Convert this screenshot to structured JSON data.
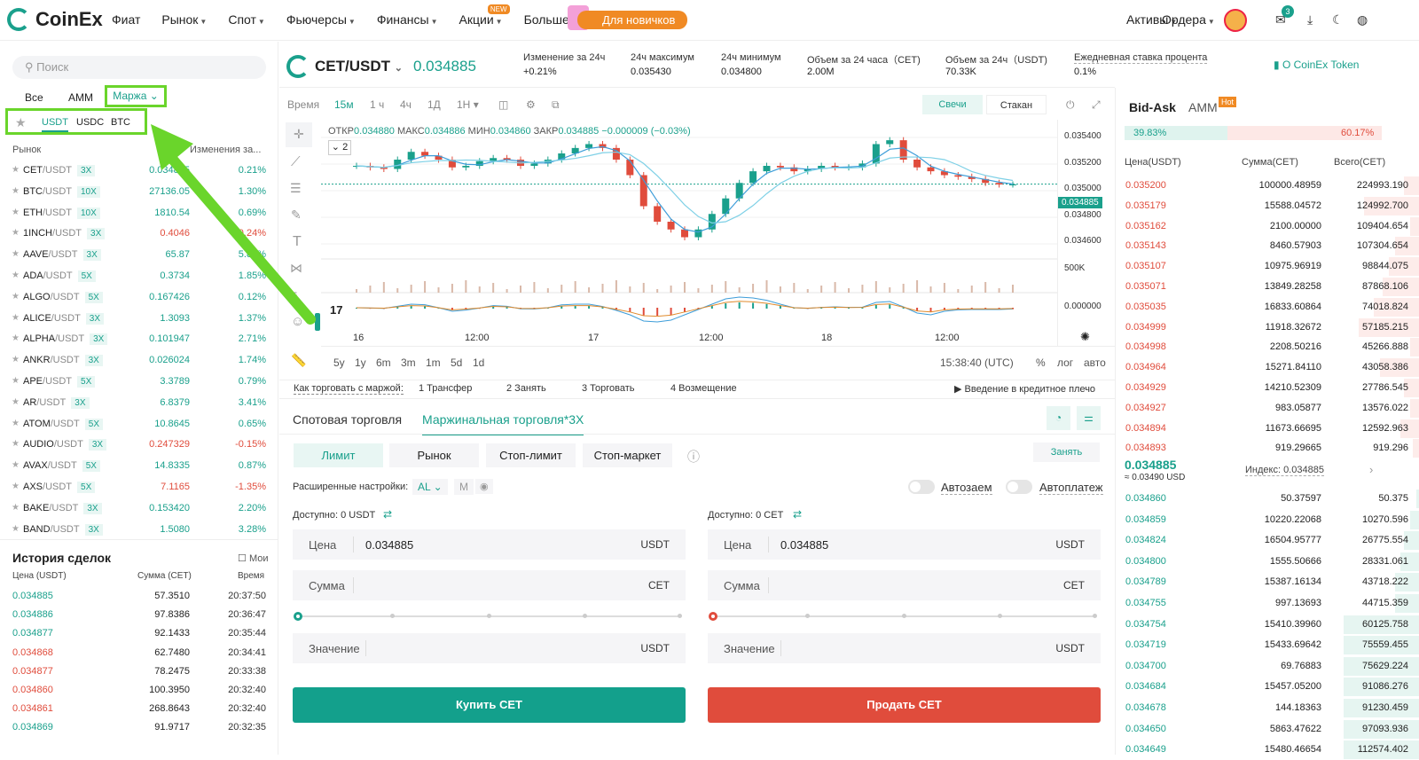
{
  "brand": "CoinEx",
  "nav": {
    "items": [
      "Фиат",
      "Рынок",
      "Спот",
      "Фьючерсы",
      "Финансы",
      "Акции",
      "Больше"
    ],
    "new_badge": "NEW",
    "promo": "Для новичков",
    "assets": "Активы",
    "orders": "Ордера",
    "notif_count": "3"
  },
  "left": {
    "search_placeholder": "Поиск",
    "tabs": [
      "Все",
      "AMM",
      "Маржа"
    ],
    "quotes": [
      "USDT",
      "USDC",
      "BTC"
    ],
    "head_market": "Рынок",
    "head_change": "Изменения за...",
    "rows": [
      {
        "base": "CET",
        "quote": "/USDT",
        "lev": "3X",
        "price": "0.034885",
        "change": "0.21%",
        "dir": "up"
      },
      {
        "base": "BTC",
        "quote": "/USDT",
        "lev": "10X",
        "price": "27136.05",
        "change": "1.30%",
        "dir": "up"
      },
      {
        "base": "ETH",
        "quote": "/USDT",
        "lev": "10X",
        "price": "1810.54",
        "change": "0.69%",
        "dir": "up"
      },
      {
        "base": "1INCH",
        "quote": "/USDT",
        "lev": "3X",
        "price": "0.4046",
        "change": "-0.24%",
        "dir": "down"
      },
      {
        "base": "AAVE",
        "quote": "/USDT",
        "lev": "3X",
        "price": "65.87",
        "change": "5.85%",
        "dir": "up"
      },
      {
        "base": "ADA",
        "quote": "/USDT",
        "lev": "5X",
        "price": "0.3734",
        "change": "1.85%",
        "dir": "up"
      },
      {
        "base": "ALGO",
        "quote": "/USDT",
        "lev": "5X",
        "price": "0.167426",
        "change": "0.12%",
        "dir": "up"
      },
      {
        "base": "ALICE",
        "quote": "/USDT",
        "lev": "3X",
        "price": "1.3093",
        "change": "1.37%",
        "dir": "up"
      },
      {
        "base": "ALPHA",
        "quote": "/USDT",
        "lev": "3X",
        "price": "0.101947",
        "change": "2.71%",
        "dir": "up"
      },
      {
        "base": "ANKR",
        "quote": "/USDT",
        "lev": "3X",
        "price": "0.026024",
        "change": "1.74%",
        "dir": "up"
      },
      {
        "base": "APE",
        "quote": "/USDT",
        "lev": "5X",
        "price": "3.3789",
        "change": "0.79%",
        "dir": "up"
      },
      {
        "base": "AR",
        "quote": "/USDT",
        "lev": "3X",
        "price": "6.8379",
        "change": "3.41%",
        "dir": "up"
      },
      {
        "base": "ATOM",
        "quote": "/USDT",
        "lev": "5X",
        "price": "10.8645",
        "change": "0.65%",
        "dir": "up"
      },
      {
        "base": "AUDIO",
        "quote": "/USDT",
        "lev": "3X",
        "price": "0.247329",
        "change": "-0.15%",
        "dir": "down"
      },
      {
        "base": "AVAX",
        "quote": "/USDT",
        "lev": "5X",
        "price": "14.8335",
        "change": "0.87%",
        "dir": "up"
      },
      {
        "base": "AXS",
        "quote": "/USDT",
        "lev": "5X",
        "price": "7.1165",
        "change": "-1.35%",
        "dir": "down"
      },
      {
        "base": "BAKE",
        "quote": "/USDT",
        "lev": "3X",
        "price": "0.153420",
        "change": "2.20%",
        "dir": "up"
      },
      {
        "base": "BAND",
        "quote": "/USDT",
        "lev": "3X",
        "price": "1.5080",
        "change": "3.28%",
        "dir": "up"
      }
    ],
    "history_title": "История сделок",
    "history_mine": "Мои",
    "hist_head": [
      "Цена (USDT)",
      "Сумма (CET)",
      "Время"
    ],
    "history": [
      {
        "p": "0.034885",
        "a": "57.3510",
        "t": "20:37:50",
        "dir": "up"
      },
      {
        "p": "0.034886",
        "a": "97.8386",
        "t": "20:36:47",
        "dir": "up"
      },
      {
        "p": "0.034877",
        "a": "92.1433",
        "t": "20:35:44",
        "dir": "up"
      },
      {
        "p": "0.034868",
        "a": "62.7480",
        "t": "20:34:41",
        "dir": "down"
      },
      {
        "p": "0.034877",
        "a": "78.2475",
        "t": "20:33:38",
        "dir": "down"
      },
      {
        "p": "0.034860",
        "a": "100.3950",
        "t": "20:32:40",
        "dir": "down"
      },
      {
        "p": "0.034861",
        "a": "268.8643",
        "t": "20:32:40",
        "dir": "down"
      },
      {
        "p": "0.034869",
        "a": "91.9717",
        "t": "20:32:35",
        "dir": "up"
      }
    ]
  },
  "pair": {
    "name": "CET/USDT",
    "price": "0.034885",
    "stats": [
      {
        "l": "Изменение за 24ч",
        "v": "+0.21%"
      },
      {
        "l": "24ч максимум",
        "v": "0.035430"
      },
      {
        "l": "24ч минимум",
        "v": "0.034800"
      },
      {
        "l": "Объем за 24 часа（CET)",
        "v": "2.00M"
      },
      {
        "l": "Объем за 24ч（USDT)",
        "v": "70.33K"
      },
      {
        "l": "Ежедневная ставка процента",
        "v": "0.1%"
      }
    ],
    "about": "О CoinEx Token"
  },
  "chart_tools": {
    "time": "Время",
    "intervals": [
      "15м",
      "1 ч",
      "4ч",
      "1Д",
      "1Н"
    ],
    "candles": "Свечи",
    "book": "Стакан"
  },
  "chart_data": {
    "type": "line",
    "ohlc_text": {
      "open_l": "ОТКР",
      "open": "0.034880",
      "high_l": "МАКС",
      "high": "0.034886",
      "low_l": "МИН",
      "low": "0.034860",
      "close_l": "ЗАКР",
      "close": "0.034885",
      "chg": "−0.000009 (−0.03%)"
    },
    "indicator_count": "2",
    "x": [
      "16",
      "12:00",
      "17",
      "12:00",
      "18",
      "12:00"
    ],
    "yticks": [
      "0.035400",
      "0.035200",
      "0.035000",
      "0.034800",
      "0.034600"
    ],
    "current": "0.034885",
    "vol_tick": "500K",
    "macd_tick": "0.000000",
    "series": [
      {
        "values": [
          0.03512,
          0.0351,
          0.03508,
          0.0352,
          0.0353,
          0.03525,
          0.0352,
          0.0351,
          0.03512,
          0.03518,
          0.03522,
          0.0352,
          0.03512,
          0.03515,
          0.0352,
          0.03528,
          0.03535,
          0.0354,
          0.03535,
          0.0352,
          0.035,
          0.0346,
          0.0344,
          0.0343,
          0.0342,
          0.0343,
          0.0345,
          0.0347,
          0.0349,
          0.03505,
          0.03512,
          0.0351,
          0.03505,
          0.03508,
          0.03512,
          0.0351,
          0.0351,
          0.03515,
          0.0354,
          0.03545,
          0.0352,
          0.0351,
          0.03505,
          0.035,
          0.03498,
          0.03495,
          0.0349,
          0.03488,
          0.03488
        ]
      }
    ]
  },
  "ranges": [
    "5y",
    "1y",
    "6m",
    "3m",
    "1m",
    "5d",
    "1d"
  ],
  "clock": "15:38:40 (UTC)",
  "scale": [
    "%",
    "лог",
    "авто"
  ],
  "steps": {
    "title": "Как торговать с маржой:",
    "items": [
      "1 Трансфер",
      "2 Занять",
      "3 Торговать",
      "4 Возмещение"
    ],
    "intro": "Введение в кредитное плечо"
  },
  "trade": {
    "tabs": [
      "Спотовая торговля",
      "Маржинальная торговля*3X"
    ],
    "order_types": [
      "Лимит",
      "Рынок",
      "Стоп-лимит",
      "Стоп-маркет"
    ],
    "borrow": "Занять",
    "adv": "Расширенные настройки:",
    "adv_al": "AL",
    "adv_m": "M",
    "auto_loan": "Автозаем",
    "auto_pay": "Автоплатеж",
    "buy": {
      "avail": "Доступно: 0 USDT",
      "price_l": "Цена",
      "price": "0.034885",
      "price_u": "USDT",
      "amount_l": "Сумма",
      "amount_u": "CET",
      "value_l": "Значение",
      "value_u": "USDT",
      "btn": "Купить CET"
    },
    "sell": {
      "avail": "Доступно: 0 CET",
      "price_l": "Цена",
      "price": "0.034885",
      "price_u": "USDT",
      "amount_l": "Сумма",
      "amount_u": "CET",
      "value_l": "Значение",
      "value_u": "USDT",
      "btn": "Продать CET"
    }
  },
  "book": {
    "tabs": [
      "Bid-Ask",
      "AMM"
    ],
    "hot": "Hot",
    "buy_pct": "39.83%",
    "sell_pct": "60.17%",
    "buy_frac": 0.3983,
    "head": [
      "Цена(USDT)",
      "Сумма(CET)",
      "Всего(CET)"
    ],
    "asks": [
      {
        "p": "0.035200",
        "s": "100000.48959",
        "t": "224993.190",
        "f": 0.05
      },
      {
        "p": "0.035179",
        "s": "15588.04572",
        "t": "124992.700",
        "f": 0.18
      },
      {
        "p": "0.035162",
        "s": "2100.00000",
        "t": "109404.654",
        "f": 0.03
      },
      {
        "p": "0.035143",
        "s": "8460.57903",
        "t": "107304.654",
        "f": 0.08
      },
      {
        "p": "0.035107",
        "s": "10975.96919",
        "t": "98844.075",
        "f": 0.1
      },
      {
        "p": "0.035071",
        "s": "13849.28258",
        "t": "87868.106",
        "f": 0.12
      },
      {
        "p": "0.035035",
        "s": "16833.60864",
        "t": "74018.824",
        "f": 0.15
      },
      {
        "p": "0.034999",
        "s": "11918.32672",
        "t": "57185.215",
        "f": 0.2
      },
      {
        "p": "0.034998",
        "s": "2208.50216",
        "t": "45266.888",
        "f": 0.03
      },
      {
        "p": "0.034964",
        "s": "15271.84110",
        "t": "43058.386",
        "f": 0.13
      },
      {
        "p": "0.034929",
        "s": "14210.52309",
        "t": "27786.545",
        "f": 0.05
      },
      {
        "p": "0.034927",
        "s": "983.05877",
        "t": "13576.022",
        "f": 0.03
      },
      {
        "p": "0.034894",
        "s": "11673.66695",
        "t": "12592.963",
        "f": 0.06
      },
      {
        "p": "0.034893",
        "s": "919.29665",
        "t": "919.296",
        "f": 0.02
      }
    ],
    "last": "0.034885",
    "last_usd": "≈ 0.03490 USD",
    "index": "Индекс: 0.034885",
    "bids": [
      {
        "p": "0.034860",
        "s": "50.37597",
        "t": "50.375",
        "f": 0.01
      },
      {
        "p": "0.034859",
        "s": "10220.22068",
        "t": "10270.596",
        "f": 0.03
      },
      {
        "p": "0.034824",
        "s": "16504.95777",
        "t": "26775.554",
        "f": 0.05
      },
      {
        "p": "0.034800",
        "s": "1555.50666",
        "t": "28331.061",
        "f": 0.06
      },
      {
        "p": "0.034789",
        "s": "15387.16134",
        "t": "43718.222",
        "f": 0.08
      },
      {
        "p": "0.034755",
        "s": "997.13693",
        "t": "44715.359",
        "f": 0.08
      },
      {
        "p": "0.034754",
        "s": "15410.39960",
        "t": "60125.758",
        "f": 0.25
      },
      {
        "p": "0.034719",
        "s": "15433.69642",
        "t": "75559.455",
        "f": 0.25
      },
      {
        "p": "0.034700",
        "s": "69.76883",
        "t": "75629.224",
        "f": 0.25
      },
      {
        "p": "0.034684",
        "s": "15457.05200",
        "t": "91086.276",
        "f": 0.25
      },
      {
        "p": "0.034678",
        "s": "144.18363",
        "t": "91230.459",
        "f": 0.25
      },
      {
        "p": "0.034650",
        "s": "5863.47622",
        "t": "97093.936",
        "f": 0.25
      },
      {
        "p": "0.034649",
        "s": "15480.46654",
        "t": "112574.402",
        "f": 0.25
      }
    ]
  }
}
